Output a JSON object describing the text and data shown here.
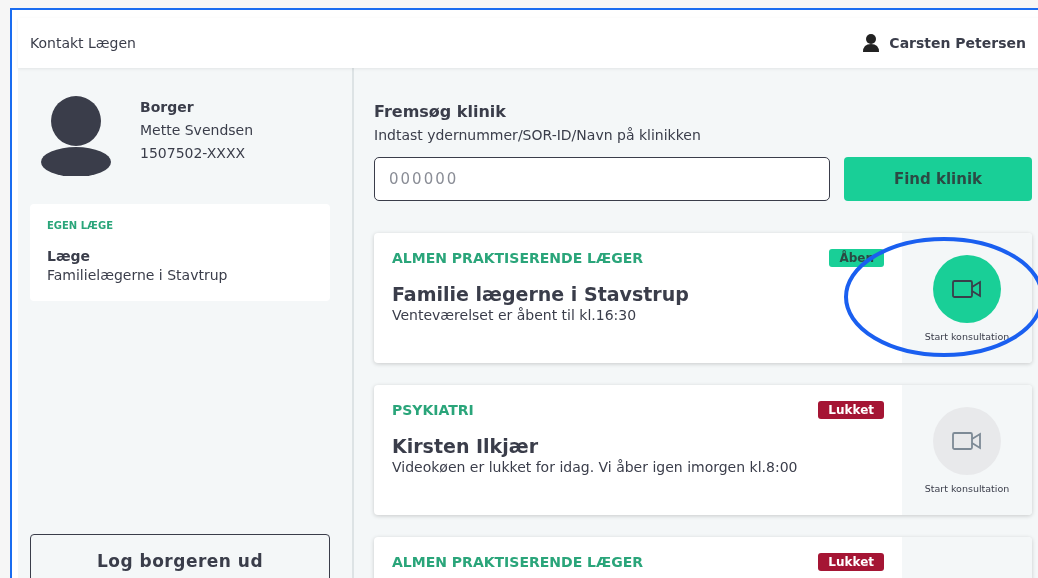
{
  "header": {
    "title": "Kontakt Lægen",
    "user": "Carsten Petersen"
  },
  "citizen": {
    "role": "Borger",
    "name": "Mette Svendsen",
    "cpr": "1507502-XXXX"
  },
  "own_doctor": {
    "heading": "EGEN LÆGE",
    "label": "Læge",
    "clinic": "Familielægerne i Stavtrup"
  },
  "logout_button": "Log borgeren ud",
  "search": {
    "title": "Fremsøg klinik",
    "hint": "Indtast ydernummer/SOR-ID/Navn på klinikken",
    "placeholder": "000000",
    "button": "Find klinik"
  },
  "clinics": [
    {
      "category": "ALMEN PRAKTISERENDE LÆGER",
      "status": "Åben",
      "open": true,
      "name": "Familie lægerne i Stavstrup",
      "message": "Venteværelset er åbent til kl.16:30",
      "action": "Start konsultation",
      "highlighted": true
    },
    {
      "category": "PSYKIATRI",
      "status": "Lukket",
      "open": false,
      "name": "Kirsten Ilkjær",
      "message": "Videokøen er lukket for idag. Vi åber igen imorgen kl.8:00",
      "action": "Start konsultation",
      "highlighted": false
    },
    {
      "category": "ALMEN PRAKTISERENDE LÆGER",
      "status": "Lukket",
      "open": false
    }
  ]
}
